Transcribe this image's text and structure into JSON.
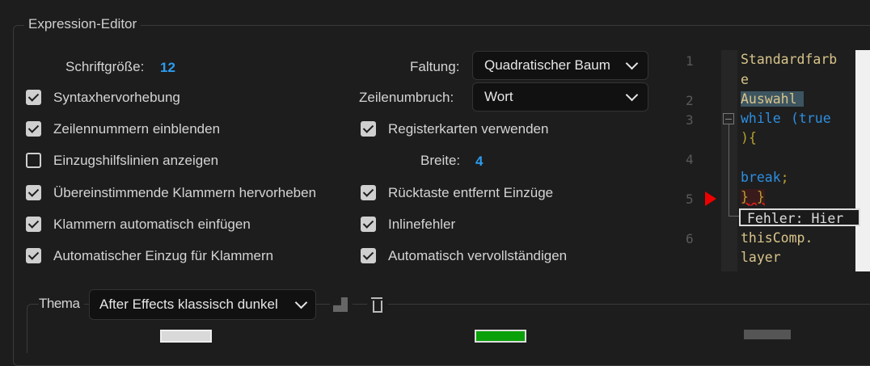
{
  "section_title": "Expression-Editor",
  "font_size": {
    "label": "Schriftgröße:",
    "value": "12"
  },
  "folding": {
    "label": "Faltung:",
    "value": "Quadratischer Baum"
  },
  "wrap": {
    "label": "Zeilenumbruch:",
    "value": "Wort"
  },
  "width": {
    "label": "Breite:",
    "value": "4"
  },
  "left_options": [
    {
      "label": "Syntaxhervorhebung",
      "checked": true
    },
    {
      "label": "Zeilennummern einblenden",
      "checked": true
    },
    {
      "label": "Einzugshilfslinien anzeigen",
      "checked": false
    },
    {
      "label": "Übereinstimmende Klammern hervorheben",
      "checked": true
    },
    {
      "label": "Klammern automatisch einfügen",
      "checked": true
    },
    {
      "label": "Automatischer Einzug für Klammern",
      "checked": true
    }
  ],
  "right_options": [
    {
      "label": "Registerkarten verwenden",
      "checked": true
    },
    {
      "label": "Rücktaste entfernt Einzüge",
      "checked": true
    },
    {
      "label": "Inlinefehler",
      "checked": true
    },
    {
      "label": "Automatisch vervollständigen",
      "checked": true
    }
  ],
  "preview": {
    "line_numbers": [
      "1",
      "2",
      "3",
      "4",
      "5",
      "6"
    ],
    "lines": [
      "Standardfarb",
      "e",
      "Auswahl",
      "while",
      "(true",
      ")",
      "{",
      "break",
      ";",
      "}",
      "}",
      "Fehler: Hier",
      "thisComp.",
      "layer"
    ]
  },
  "theme": {
    "label": "Thema",
    "value": "After Effects klassisch dunkel"
  },
  "colors": {
    "swatch1": "#d9d9d9",
    "swatch2": "#0aa00a",
    "swatch3": "#555555"
  }
}
